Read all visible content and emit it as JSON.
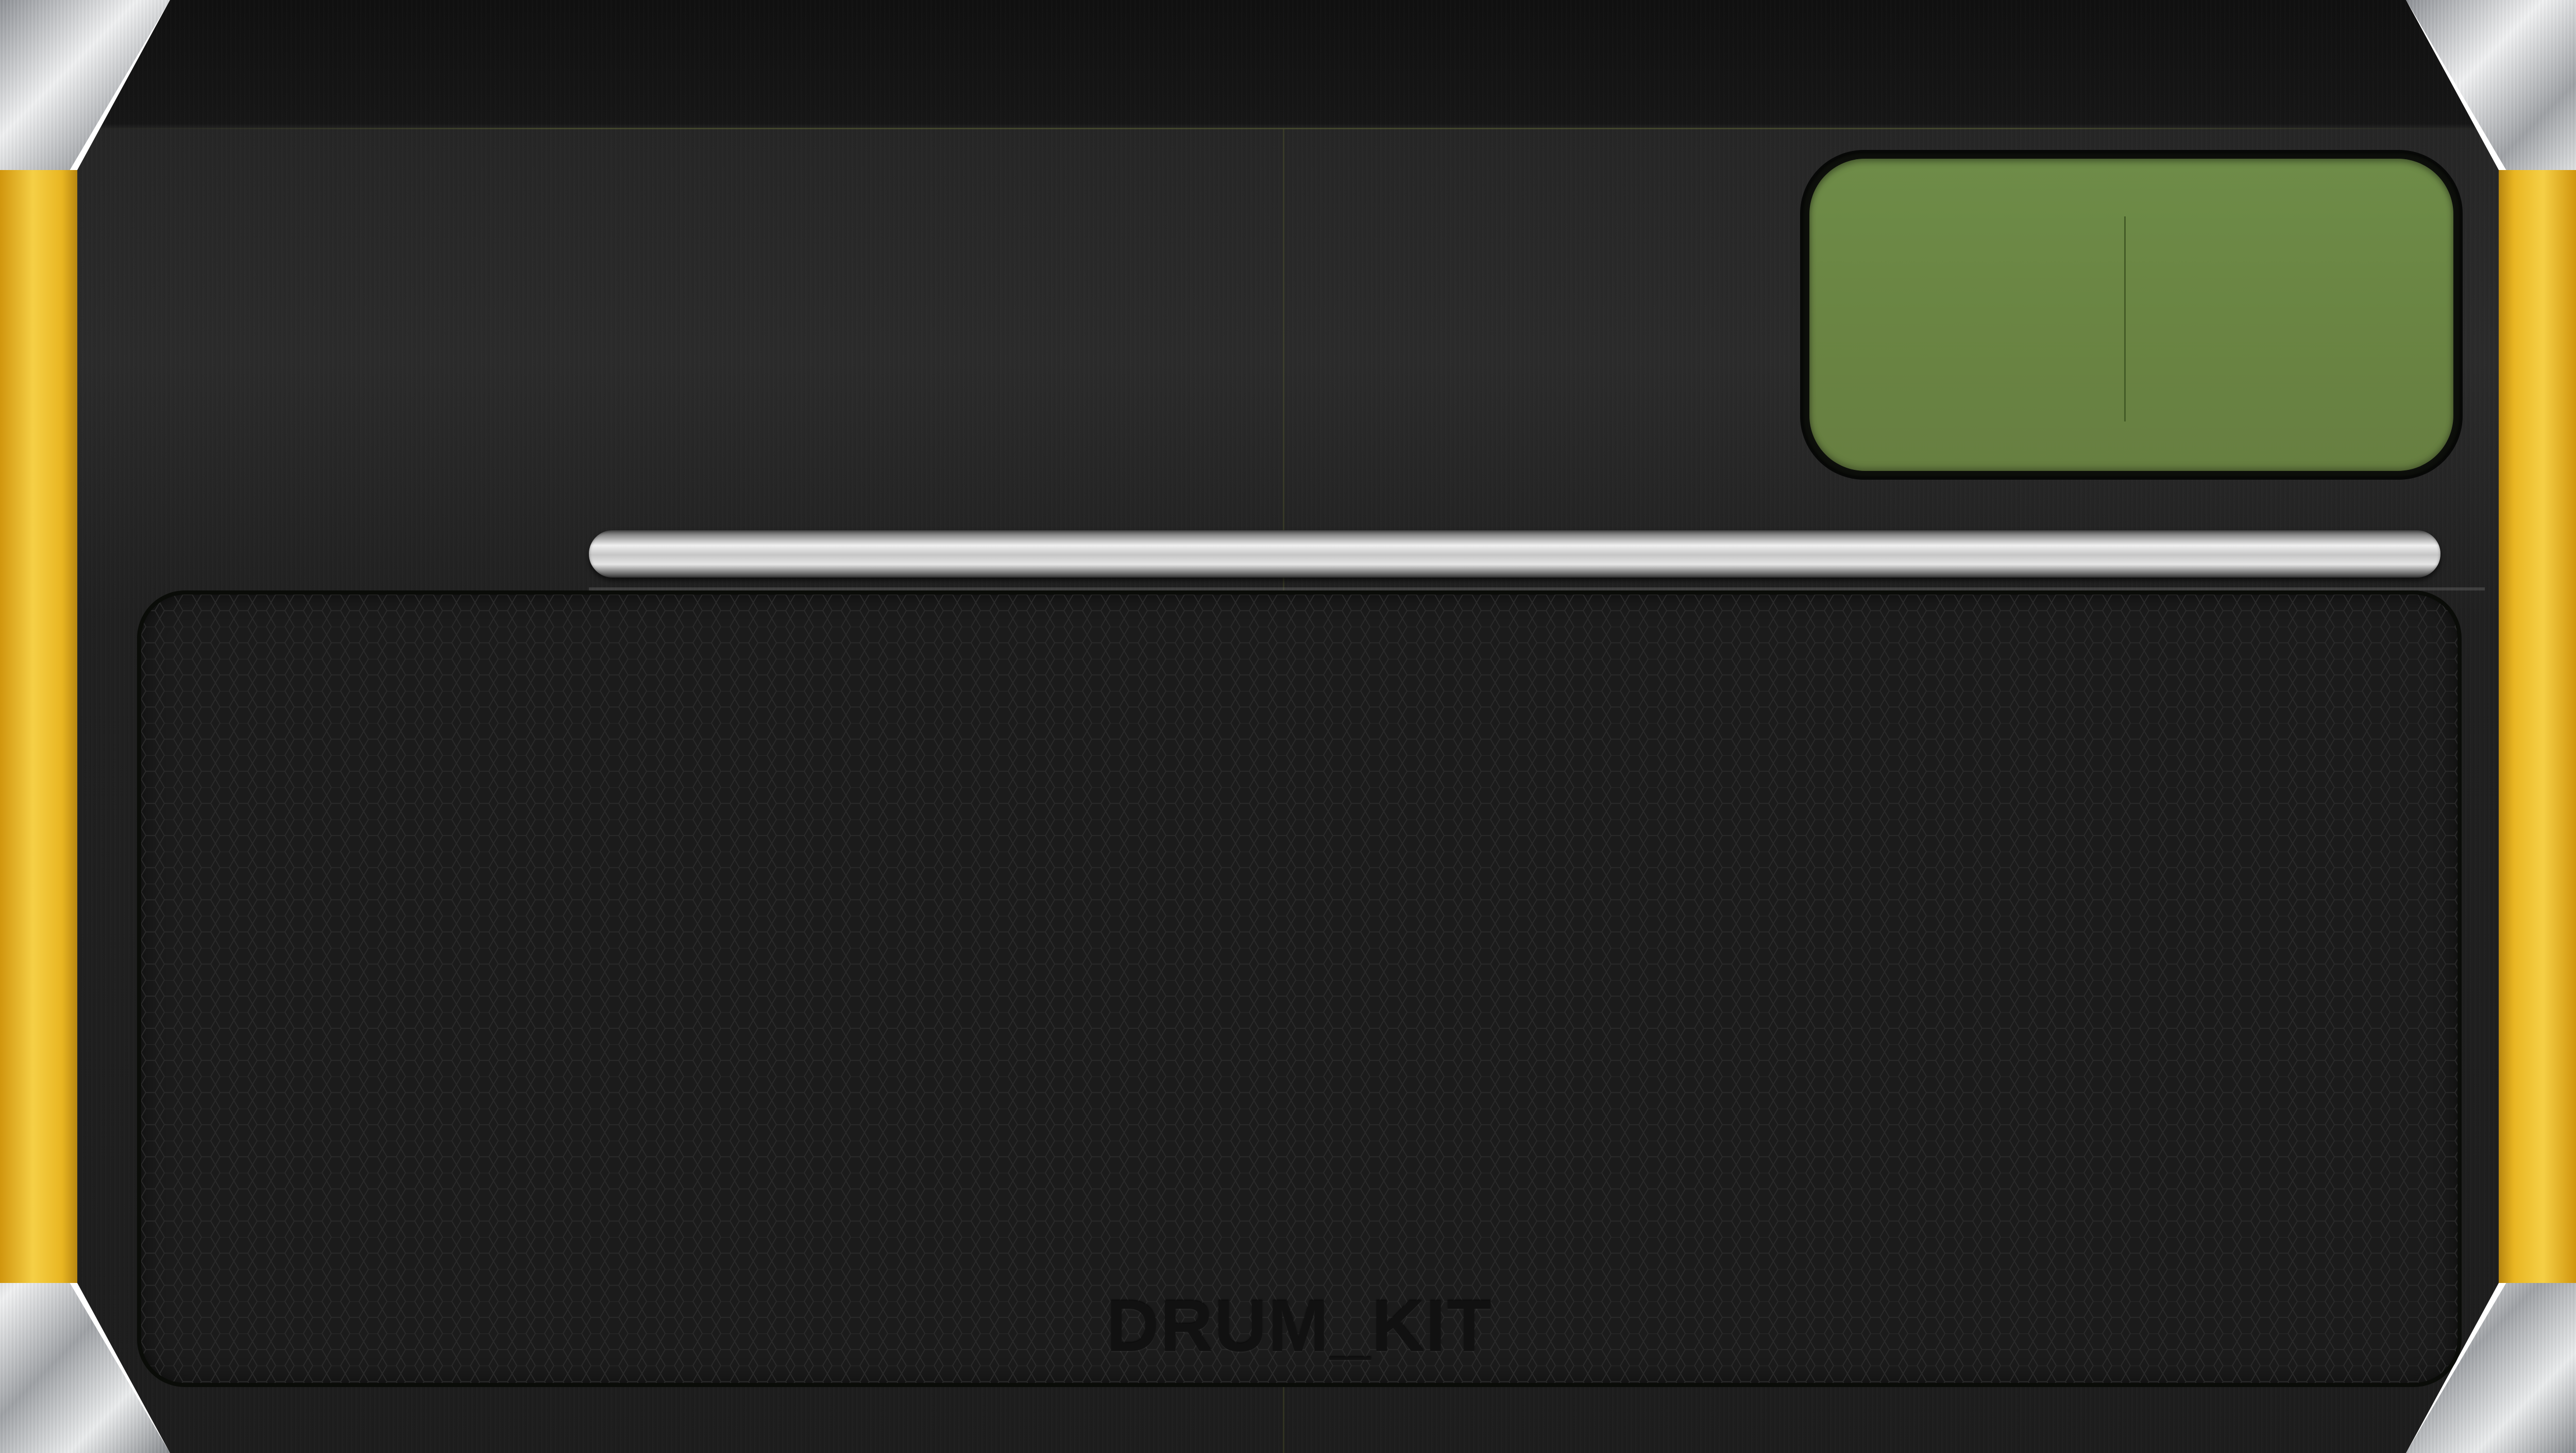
{
  "app": {
    "pad_label": "DRUM_KIT"
  },
  "display": {
    "content": ""
  },
  "position_bar": {
    "progress": 0.0
  },
  "colors": {
    "lcd_green": "#6a8543",
    "rail_gold": "#f5cf45",
    "body_dark": "#2b2b2b",
    "steel": "#e0e2e4"
  },
  "icons": []
}
